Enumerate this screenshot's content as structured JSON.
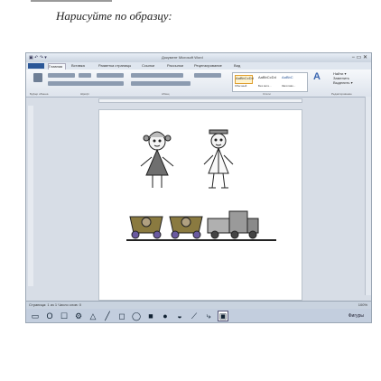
{
  "caption": "Нарисуйте по образцу:",
  "window": {
    "quick_access": "▣ ↶ ↷ ▾",
    "title": "Документ Microsoft Word",
    "controls": "− ▭ ✕"
  },
  "ribbon": {
    "tabs": [
      "Главная",
      "Вставка",
      "Разметка страницы",
      "Ссылки",
      "Рассылки",
      "Рецензирование",
      "Вид"
    ],
    "styles": [
      "AaBbCcDd",
      "AaBbCcDd",
      "AaBbC"
    ],
    "style_names": [
      "Обычный",
      "Без инте...",
      "Заголово..."
    ],
    "edit": [
      "Найти ▾",
      "Заменить",
      "Выделить ▾"
    ],
    "groups": [
      "Буфер обмена",
      "Шрифт",
      "Абзац",
      "Стили",
      "Редактирование"
    ]
  },
  "statusbar": {
    "left": "Страница: 1 из 1   Число слов: 0",
    "right": "100%"
  },
  "taskbar": {
    "tools": [
      "▭",
      "O",
      "☐",
      "⚙",
      "△",
      "╱",
      "◻",
      "◯",
      "■",
      "●",
      "◒",
      "⟋",
      "⤷",
      "▣"
    ],
    "selected_index": 13,
    "right_text": "Фигуры"
  },
  "icons": {
    "cursor": "pointer-icon"
  }
}
